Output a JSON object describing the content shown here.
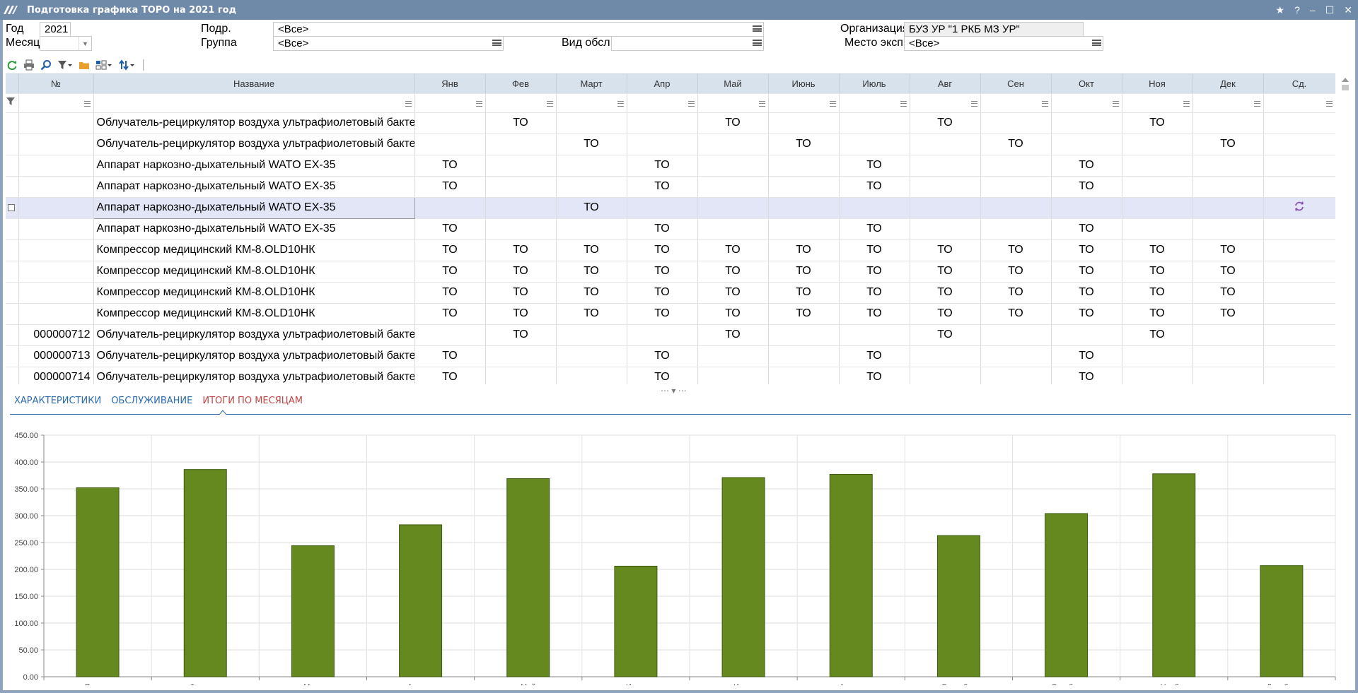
{
  "window": {
    "title": "Подготовка графика ТОРО на 2021 год"
  },
  "filters": {
    "year_label": "Год",
    "year_value": "2021",
    "month_label": "Месяц",
    "month_value": "",
    "podr_label": "Подр.",
    "podr_value": "<Все>",
    "group_label": "Группа",
    "group_value": "<Все>",
    "vid_label": "Вид обсл.",
    "vid_value": "",
    "org_label": "Организация",
    "org_value": "БУЗ УР \"1 РКБ МЗ УР\"",
    "mesto_label": "Место эксп.",
    "mesto_value": "<Все>"
  },
  "toolbar": [
    "refresh-icon",
    "print-icon",
    "find-icon",
    "filter-icon",
    "folder-icon",
    "layout-icon",
    "sort-icon"
  ],
  "grid": {
    "columns": {
      "num": "№",
      "name": "Название",
      "months": [
        "Янв",
        "Фев",
        "Март",
        "Апр",
        "Май",
        "Июнь",
        "Июль",
        "Авг",
        "Сен",
        "Окт",
        "Ноя",
        "Дек"
      ],
      "last": "Сд."
    },
    "rows": [
      {
        "num": "",
        "name": "Облучатель-рециркулятор воздуха ультрафиолетовый бакте",
        "m": [
          "",
          "ТО",
          "",
          "",
          "ТО",
          "",
          "",
          "ТО",
          "",
          "",
          "ТО",
          ""
        ]
      },
      {
        "num": "",
        "name": "Облучатель-рециркулятор воздуха ультрафиолетовый бакте",
        "m": [
          "",
          "",
          "ТО",
          "",
          "",
          "ТО",
          "",
          "",
          "ТО",
          "",
          "",
          "ТО"
        ]
      },
      {
        "num": "",
        "name": "Аппарат наркозно-дыхательный WATO EX-35",
        "m": [
          "ТО",
          "",
          "",
          "ТО",
          "",
          "",
          "ТО",
          "",
          "",
          "ТО",
          "",
          ""
        ]
      },
      {
        "num": "",
        "name": "Аппарат наркозно-дыхательный WATO EX-35",
        "m": [
          "ТО",
          "",
          "",
          "ТО",
          "",
          "",
          "ТО",
          "",
          "",
          "ТО",
          "",
          ""
        ]
      },
      {
        "num": "",
        "name": "Аппарат наркозно-дыхательный WATO EX-35",
        "m": [
          "",
          "",
          "ТО",
          "",
          "",
          "",
          "",
          "",
          "",
          "",
          "",
          ""
        ]
      },
      {
        "num": "",
        "name": "Аппарат наркозно-дыхательный WATO EX-35",
        "m": [
          "ТО",
          "",
          "",
          "ТО",
          "",
          "",
          "ТО",
          "",
          "",
          "ТО",
          "",
          ""
        ]
      },
      {
        "num": "",
        "name": "Компрессор медицинский КМ-8.OLD10НК",
        "m": [
          "ТО",
          "ТО",
          "ТО",
          "ТО",
          "ТО",
          "ТО",
          "ТО",
          "ТО",
          "ТО",
          "ТО",
          "ТО",
          "ТО"
        ]
      },
      {
        "num": "",
        "name": "Компрессор медицинский КМ-8.OLD10НК",
        "m": [
          "ТО",
          "ТО",
          "ТО",
          "ТО",
          "ТО",
          "ТО",
          "ТО",
          "ТО",
          "ТО",
          "ТО",
          "ТО",
          "ТО"
        ]
      },
      {
        "num": "",
        "name": "Компрессор медицинский КМ-8.OLD10НК",
        "m": [
          "ТО",
          "ТО",
          "ТО",
          "ТО",
          "ТО",
          "ТО",
          "ТО",
          "ТО",
          "ТО",
          "ТО",
          "ТО",
          "ТО"
        ]
      },
      {
        "num": "",
        "name": "Компрессор медицинский КМ-8.OLD10НК",
        "m": [
          "ТО",
          "ТО",
          "ТО",
          "ТО",
          "ТО",
          "ТО",
          "ТО",
          "ТО",
          "ТО",
          "ТО",
          "ТО",
          "ТО"
        ]
      },
      {
        "num": "000000712",
        "name": "Облучатель-рециркулятор воздуха ультрафиолетовый бакте",
        "m": [
          "",
          "ТО",
          "",
          "",
          "ТО",
          "",
          "",
          "ТО",
          "",
          "",
          "ТО",
          ""
        ]
      },
      {
        "num": "000000713",
        "name": "Облучатель-рециркулятор воздуха ультрафиолетовый бакте",
        "m": [
          "ТО",
          "",
          "",
          "ТО",
          "",
          "",
          "ТО",
          "",
          "",
          "ТО",
          "",
          ""
        ]
      },
      {
        "num": "000000714",
        "name": "Облучатель-рециркулятор воздуха ультрафиолетовый бакте",
        "m": [
          "ТО",
          "",
          "",
          "ТО",
          "",
          "",
          "ТО",
          "",
          "",
          "ТО",
          "",
          ""
        ]
      }
    ]
  },
  "tabs": [
    "ХАРАКТЕРИСТИКИ",
    "ОБСЛУЖИВАНИЕ",
    "ИТОГИ ПО МЕСЯЦАМ"
  ],
  "colors": {
    "bar": "#65891f",
    "bar_stroke": "#3d5a10",
    "titlebar": "#6f89a8",
    "header": "#d8e2ec",
    "selected_row": "#e3e6f6",
    "tab_active": "#c04646",
    "tab": "#2c6bb0"
  },
  "chart_data": {
    "type": "bar",
    "categories": [
      "Январь",
      "Февраль",
      "Март",
      "Апрель",
      "Май",
      "Июнь",
      "Июль",
      "Август",
      "Сентябрь",
      "Октябрь",
      "Ноябрь",
      "Декабрь"
    ],
    "values": [
      352,
      386,
      244,
      283,
      369,
      206,
      371,
      377,
      263,
      304,
      378,
      207
    ],
    "ylim": [
      0,
      450
    ],
    "yticks": [
      "0.00",
      "50.00",
      "100.00",
      "150.00",
      "200.00",
      "250.00",
      "300.00",
      "350.00",
      "400.00",
      "450.00"
    ],
    "grid": true
  }
}
